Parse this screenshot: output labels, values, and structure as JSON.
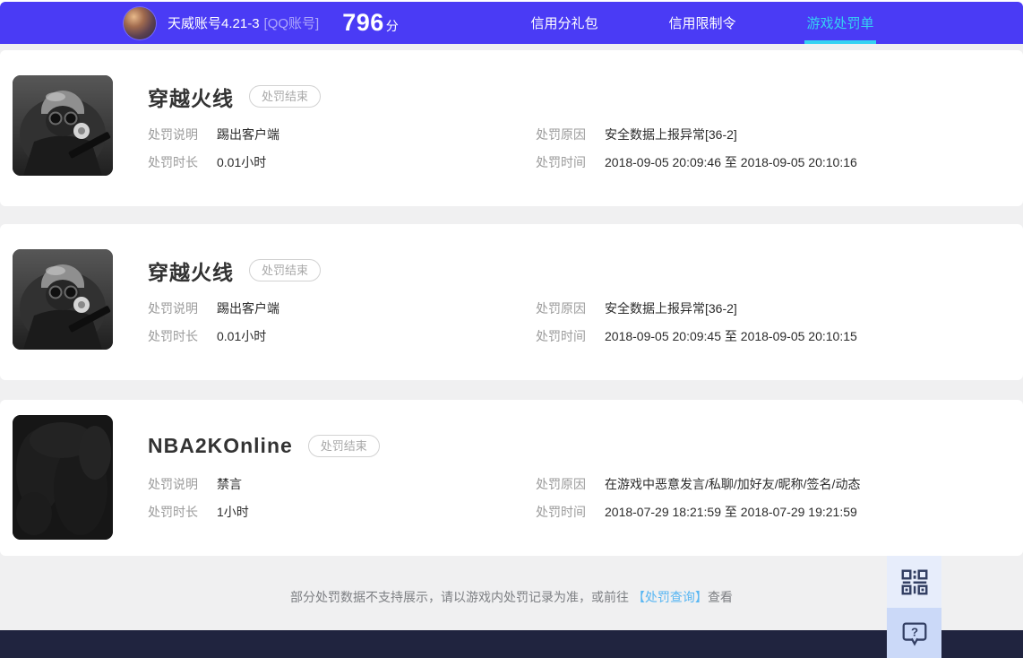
{
  "header": {
    "account_name": "天威账号4.21-3",
    "account_tag": "[QQ账号]",
    "score_value": "796",
    "score_unit": "分",
    "nav_items": [
      {
        "label": "信用分礼包",
        "active": false
      },
      {
        "label": "信用限制令",
        "active": false
      },
      {
        "label": "游戏处罚单",
        "active": true
      }
    ]
  },
  "labels": {
    "desc": "处罚说明",
    "reason": "处罚原因",
    "duration": "处罚时长",
    "time": "处罚时间"
  },
  "cards": [
    {
      "game": "穿越火线",
      "status": "处罚结束",
      "desc": "踢出客户端",
      "reason": "安全数据上报异常[36-2]",
      "duration": "0.01小时",
      "time": "2018-09-05 20:09:46 至 2018-09-05 20:10:16"
    },
    {
      "game": "穿越火线",
      "status": "处罚结束",
      "desc": "踢出客户端",
      "reason": "安全数据上报异常[36-2]",
      "duration": "0.01小时",
      "time": "2018-09-05 20:09:45 至 2018-09-05 20:10:15"
    },
    {
      "game": "NBA2KOnline",
      "status": "处罚结束",
      "desc": "禁言",
      "reason": "在游戏中恶意发言/私聊/加好友/昵称/签名/动态",
      "duration": "1小时",
      "time": "2018-07-29 18:21:59 至 2018-07-29 19:21:59"
    }
  ],
  "footer": {
    "notice_prefix": "部分处罚数据不支持展示，请以游戏内处罚记录为准，或前往 ",
    "link_label": "【处罚查询】",
    "notice_suffix": "查看"
  },
  "icons": {
    "qr": "qr-code-icon",
    "help": "help-bubble-icon"
  },
  "colors": {
    "header_bg": "#4a3bf5",
    "active_tab": "#35d2f2",
    "link": "#58b6f2",
    "bottom_bar": "#20243f",
    "page_bg": "#f0f0f1",
    "qr_button_bg": "#e7edfb",
    "help_button_bg": "#cbd9f8"
  }
}
